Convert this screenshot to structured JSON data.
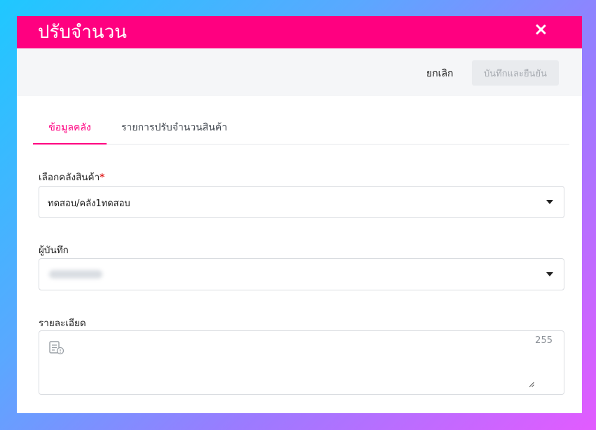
{
  "modal": {
    "title": "ปรับจำนวน"
  },
  "actions": {
    "cancel_label": "ยกเลิก",
    "save_label": "บันทึกและยืนยัน"
  },
  "tabs": [
    {
      "label": "ข้อมูลคลัง",
      "active": true
    },
    {
      "label": "รายการปรับจำนวนสินค้า",
      "active": false
    }
  ],
  "form": {
    "warehouse": {
      "label": "เลือกคลังสินค้า",
      "required_mark": "*",
      "value": "ทดสอบ/คลัง1ทดสอบ"
    },
    "recorder": {
      "label": "ผู้บันทึก"
    },
    "details": {
      "label": "รายละเอียด",
      "char_count": "255"
    }
  },
  "colors": {
    "brand": "#ff0080",
    "action_bar": "#f5f6f8",
    "disabled_button": "#e9ebee"
  }
}
